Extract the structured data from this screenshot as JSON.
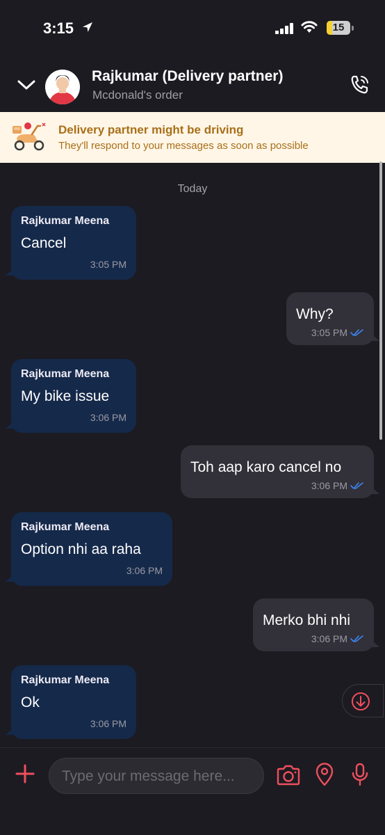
{
  "status_bar": {
    "time": "3:15",
    "battery": "15"
  },
  "header": {
    "name": "Rajkumar (Delivery partner)",
    "subtitle": "Mcdonald's order"
  },
  "banner": {
    "title": "Delivery partner might be driving",
    "subtitle": "They'll respond to your messages as soon as possible"
  },
  "day_label": "Today",
  "messages": [
    {
      "direction": "incoming",
      "sender": "Rajkumar Meena",
      "text": "Cancel",
      "time": "3:05 PM"
    },
    {
      "direction": "outgoing",
      "text": "Why?",
      "time": "3:05 PM",
      "read": true
    },
    {
      "direction": "incoming",
      "sender": "Rajkumar Meena",
      "text": "My bike issue",
      "time": "3:06 PM"
    },
    {
      "direction": "outgoing",
      "text": "Toh aap karo cancel no",
      "time": "3:06 PM",
      "read": true
    },
    {
      "direction": "incoming",
      "sender": "Rajkumar Meena",
      "text": "Option nhi aa raha",
      "time": "3:06 PM"
    },
    {
      "direction": "outgoing",
      "text": "Merko bhi nhi",
      "time": "3:06 PM",
      "read": true
    },
    {
      "direction": "incoming",
      "sender": "Rajkumar Meena",
      "text": "Ok",
      "time": "3:06 PM"
    }
  ],
  "composer": {
    "placeholder": "Type your message here..."
  },
  "icons": {
    "accent": "#ef4f5f",
    "tick_color": "#3d86f5",
    "names": [
      "location-arrow-icon",
      "signal-icon",
      "wifi-icon",
      "battery-icon",
      "chevron-down-icon",
      "avatar",
      "call-icon",
      "scooter-icon",
      "scroll-down-icon",
      "plus-icon",
      "camera-icon",
      "location-pin-icon",
      "mic-icon",
      "double-tick-icon"
    ]
  }
}
